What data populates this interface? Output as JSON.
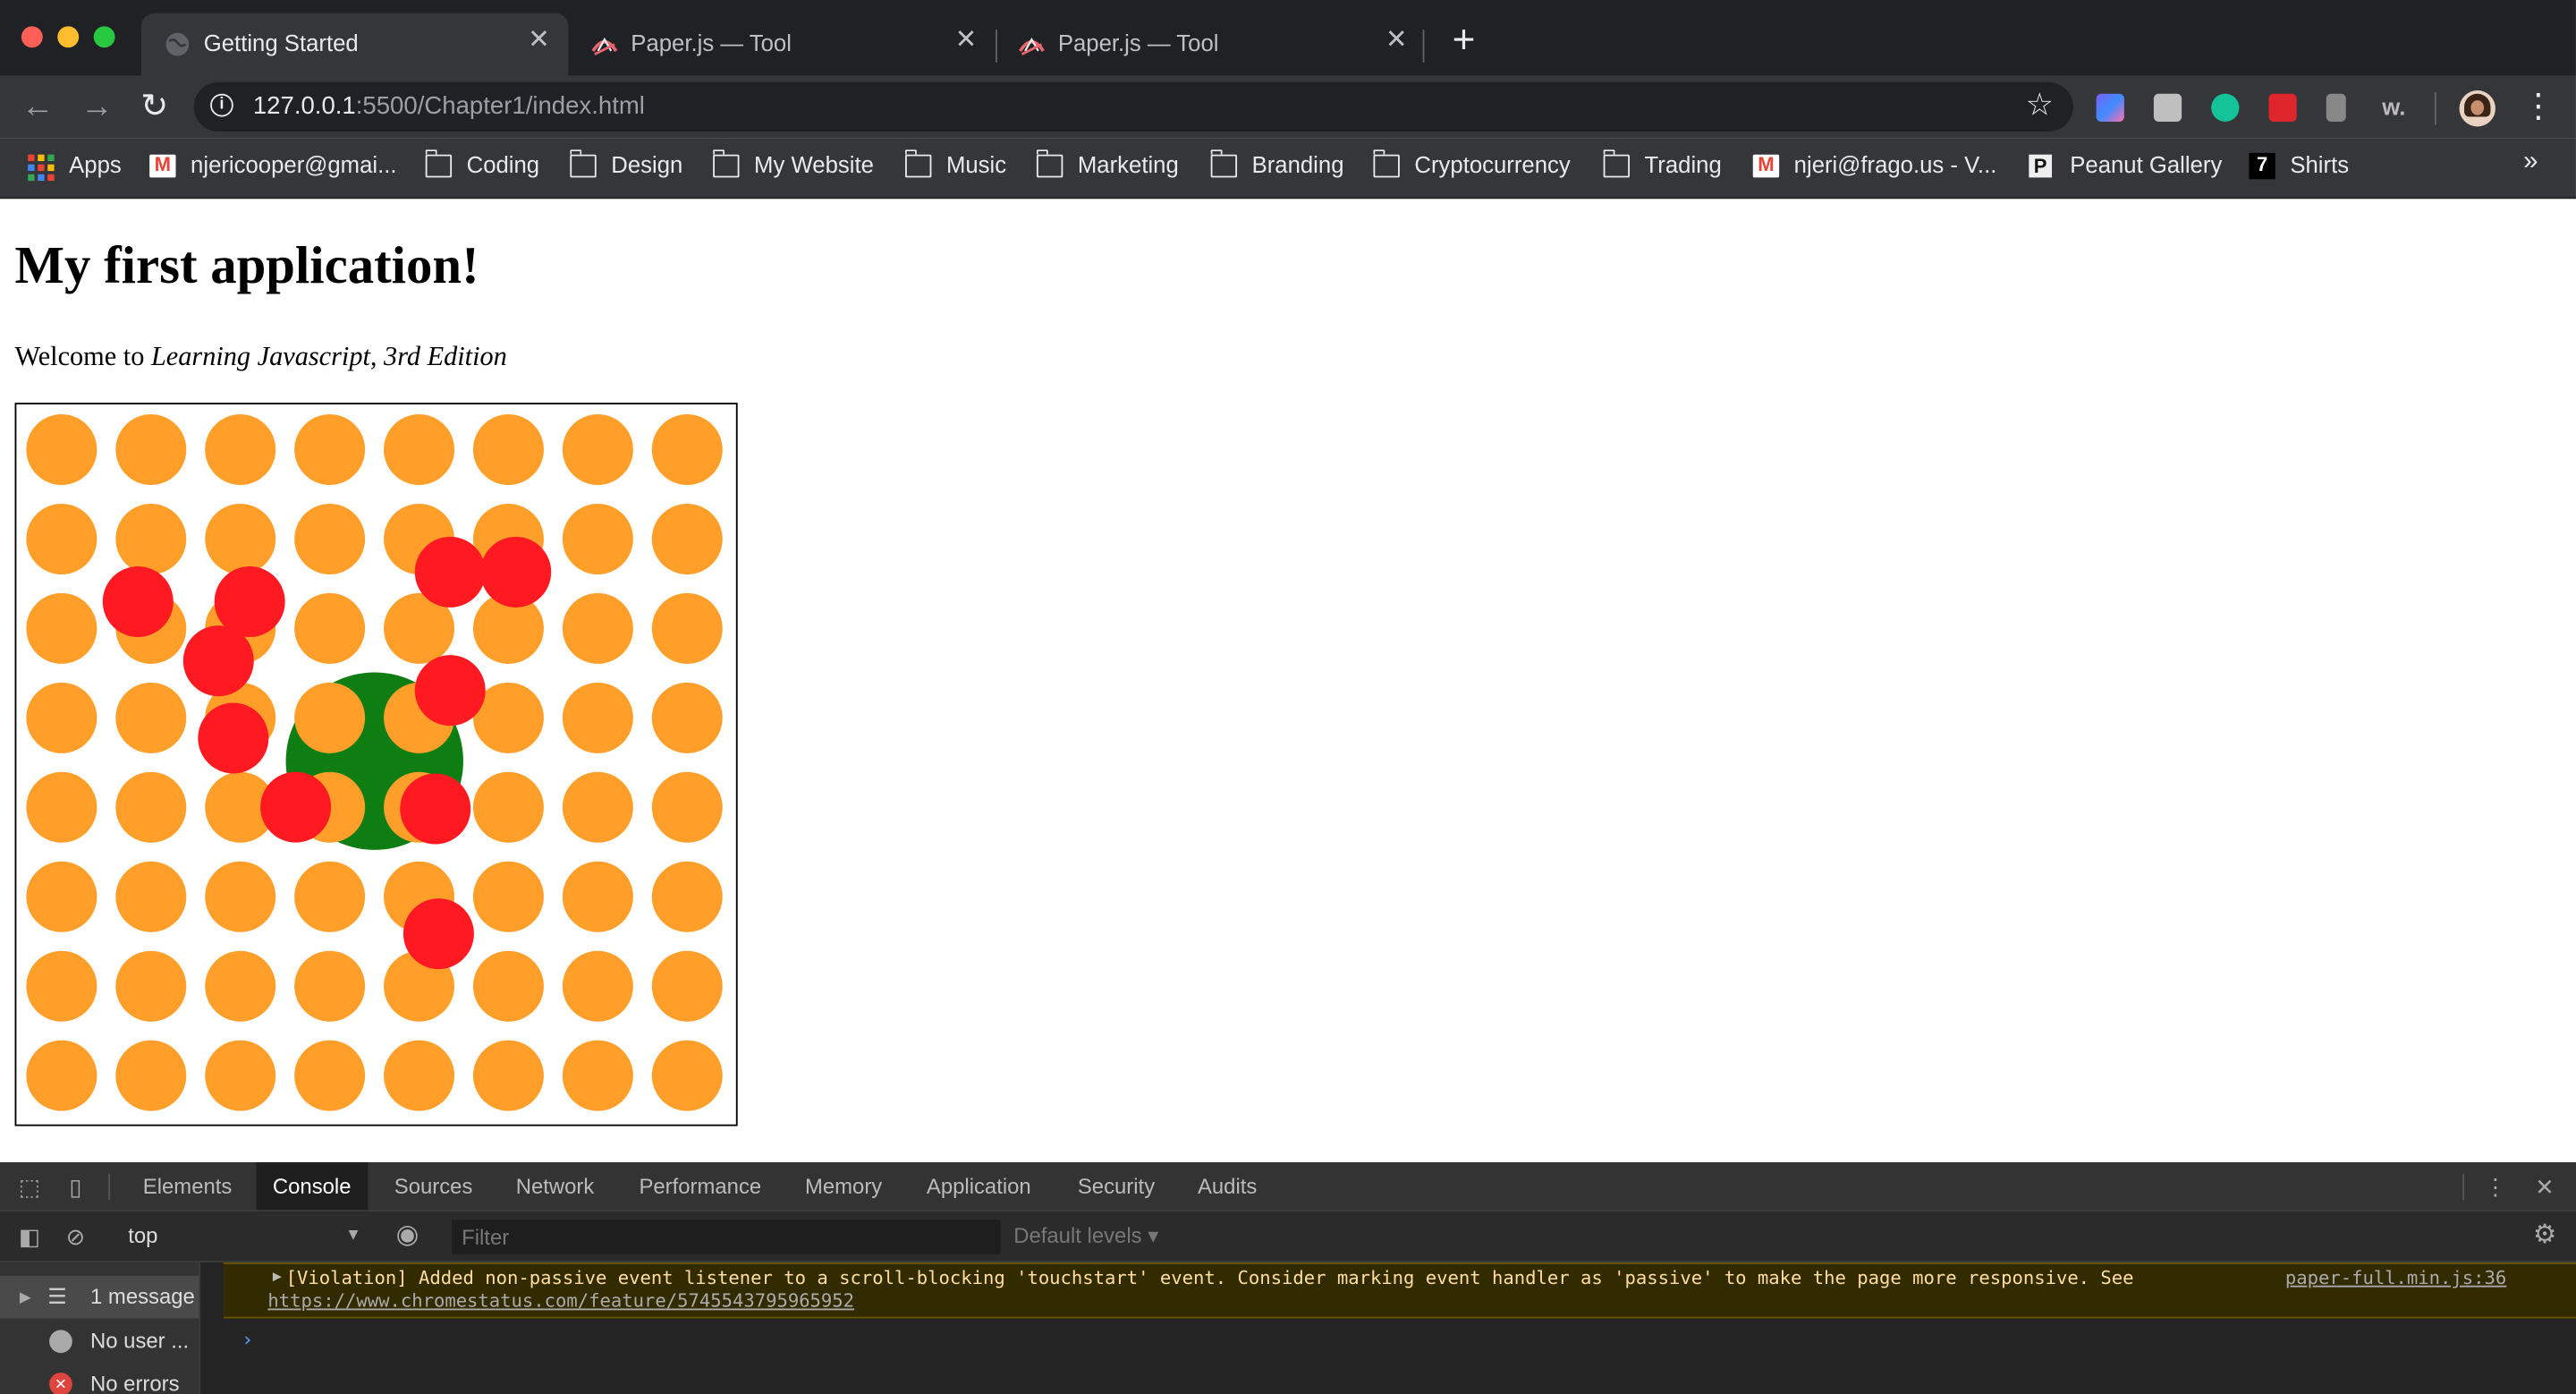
{
  "browser": {
    "tabs": [
      {
        "title": "Getting Started",
        "active": true,
        "favicon": "globe-icon"
      },
      {
        "title": "Paper.js — Tool",
        "active": false,
        "favicon": "paperjs-icon"
      },
      {
        "title": "Paper.js — Tool",
        "active": false,
        "favicon": "paperjs-icon"
      }
    ],
    "url_host": "127.0.0.1",
    "url_path": ":5500/Chapter1/index.html",
    "bookmarks": [
      {
        "label": "Apps",
        "icon": "apps-grid-icon"
      },
      {
        "label": "njericooper@gmai...",
        "icon": "gmail-icon"
      },
      {
        "label": "Coding",
        "icon": "folder-icon"
      },
      {
        "label": "Design",
        "icon": "folder-icon"
      },
      {
        "label": "My Website",
        "icon": "folder-icon"
      },
      {
        "label": "Music",
        "icon": "folder-icon"
      },
      {
        "label": "Marketing",
        "icon": "folder-icon"
      },
      {
        "label": "Branding",
        "icon": "folder-icon"
      },
      {
        "label": "Cryptocurrency",
        "icon": "folder-icon"
      },
      {
        "label": "Trading",
        "icon": "folder-icon"
      },
      {
        "label": "njeri@frago.us - V...",
        "icon": "gmail-icon"
      },
      {
        "label": "Peanut Gallery",
        "icon": "peanut-gallery-icon"
      },
      {
        "label": "Shirts",
        "icon": "shirts-icon"
      }
    ],
    "more_bookmarks": "»"
  },
  "page": {
    "heading": "My first application!",
    "intro_prefix": "Welcome to ",
    "intro_title": "Learning Javascript, 3rd Edition",
    "canvas": {
      "grid_cols": 8,
      "grid_rows": 8,
      "colors": {
        "grid_dot": "#ff9f2a",
        "big_circle": "#0e7d12",
        "red_dot": "#ff1a22"
      }
    }
  },
  "devtools": {
    "tabs": [
      "Elements",
      "Console",
      "Sources",
      "Network",
      "Performance",
      "Memory",
      "Application",
      "Security",
      "Audits"
    ],
    "active_tab": "Console",
    "context": "top",
    "filter_placeholder": "Filter",
    "levels": "Default levels ▾",
    "sidebar": [
      {
        "label": "1 message",
        "icon": "list-icon"
      },
      {
        "label": "No user ...",
        "icon": "user-icon"
      },
      {
        "label": "No errors",
        "icon": "error-icon"
      }
    ],
    "violation_message": "[Violation] Added non-passive event listener to a scroll-blocking 'touchstart' event. Consider marking event handler as 'passive' to make the page more responsive. See",
    "violation_source": "paper-full.min.js:36",
    "violation_link": "https://www.chromestatus.com/feature/5745543795965952",
    "prompt_symbol": "›"
  }
}
